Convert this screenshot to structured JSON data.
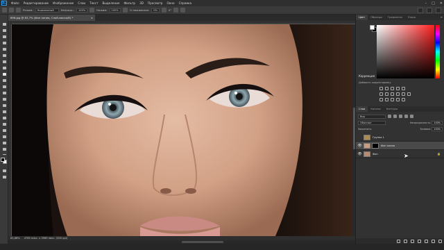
{
  "app": {
    "logo": "Ps",
    "menu": [
      "Файл",
      "Редактирование",
      "Изображение",
      "Слои",
      "Текст",
      "Выделение",
      "Фильтр",
      "3D",
      "Просмотр",
      "Окно",
      "Справка"
    ],
    "window_controls": [
      "–",
      "□",
      "✕"
    ]
  },
  "options": {
    "mode_label": "Режим:",
    "mode_value": "Нормальный",
    "opacity_label": "Непрозр.:",
    "opacity_value": "100%",
    "pressure_label": "Нажим:",
    "pressure_value": "100%",
    "smoothing_label": "Сглаживание:",
    "smoothing_value": "0%",
    "angle_value": "0°"
  },
  "document": {
    "tab_title": "896.jpg @ 83,7% (Фон копия, Слой-маска/8) *",
    "tab_close": "×",
    "zoom": "83,68%",
    "info": "4765 пикс. x 3969 пикс. (300 ppi)"
  },
  "panels": {
    "top_tabs": [
      "Цвет",
      "Образцы",
      "Градиенты",
      "Узоры"
    ],
    "menu_glyph": "≡",
    "adjustments_title": "Коррекция",
    "adjustments_sub": "Добавить корректировку",
    "layers_tabs": [
      "Слои",
      "Каналы",
      "Контуры"
    ],
    "layers": {
      "filter_kind": "Вид",
      "blend_mode": "Обычные",
      "opacity_label": "Непрозрачность:",
      "opacity_value": "100%",
      "lock_label": "Закрепить:",
      "fill_label": "Заливка:",
      "fill_value": "100%",
      "items": [
        {
          "name": "Группа 1",
          "visible": false,
          "locked": false
        },
        {
          "name": "Фон копия",
          "visible": true,
          "locked": false
        },
        {
          "name": "Фон",
          "visible": true,
          "locked": true
        }
      ],
      "eye_glyph": "👁",
      "lock_glyph": "🔒"
    }
  },
  "colors": {
    "foreground": "#000000",
    "background": "#ffffff",
    "accent": "#31a8ff"
  },
  "icons": {
    "tools": [
      "move-icon",
      "marquee-icon",
      "lasso-icon",
      "quick-select-icon",
      "crop-icon",
      "frame-icon",
      "eyedropper-icon",
      "healing-icon",
      "brush-icon",
      "clone-stamp-icon",
      "history-brush-icon",
      "eraser-icon",
      "gradient-icon",
      "blur-icon",
      "dodge-icon",
      "pen-icon",
      "type-icon",
      "path-select-icon",
      "rectangle-icon",
      "hand-icon",
      "zoom-icon",
      "more-tools-icon"
    ]
  }
}
